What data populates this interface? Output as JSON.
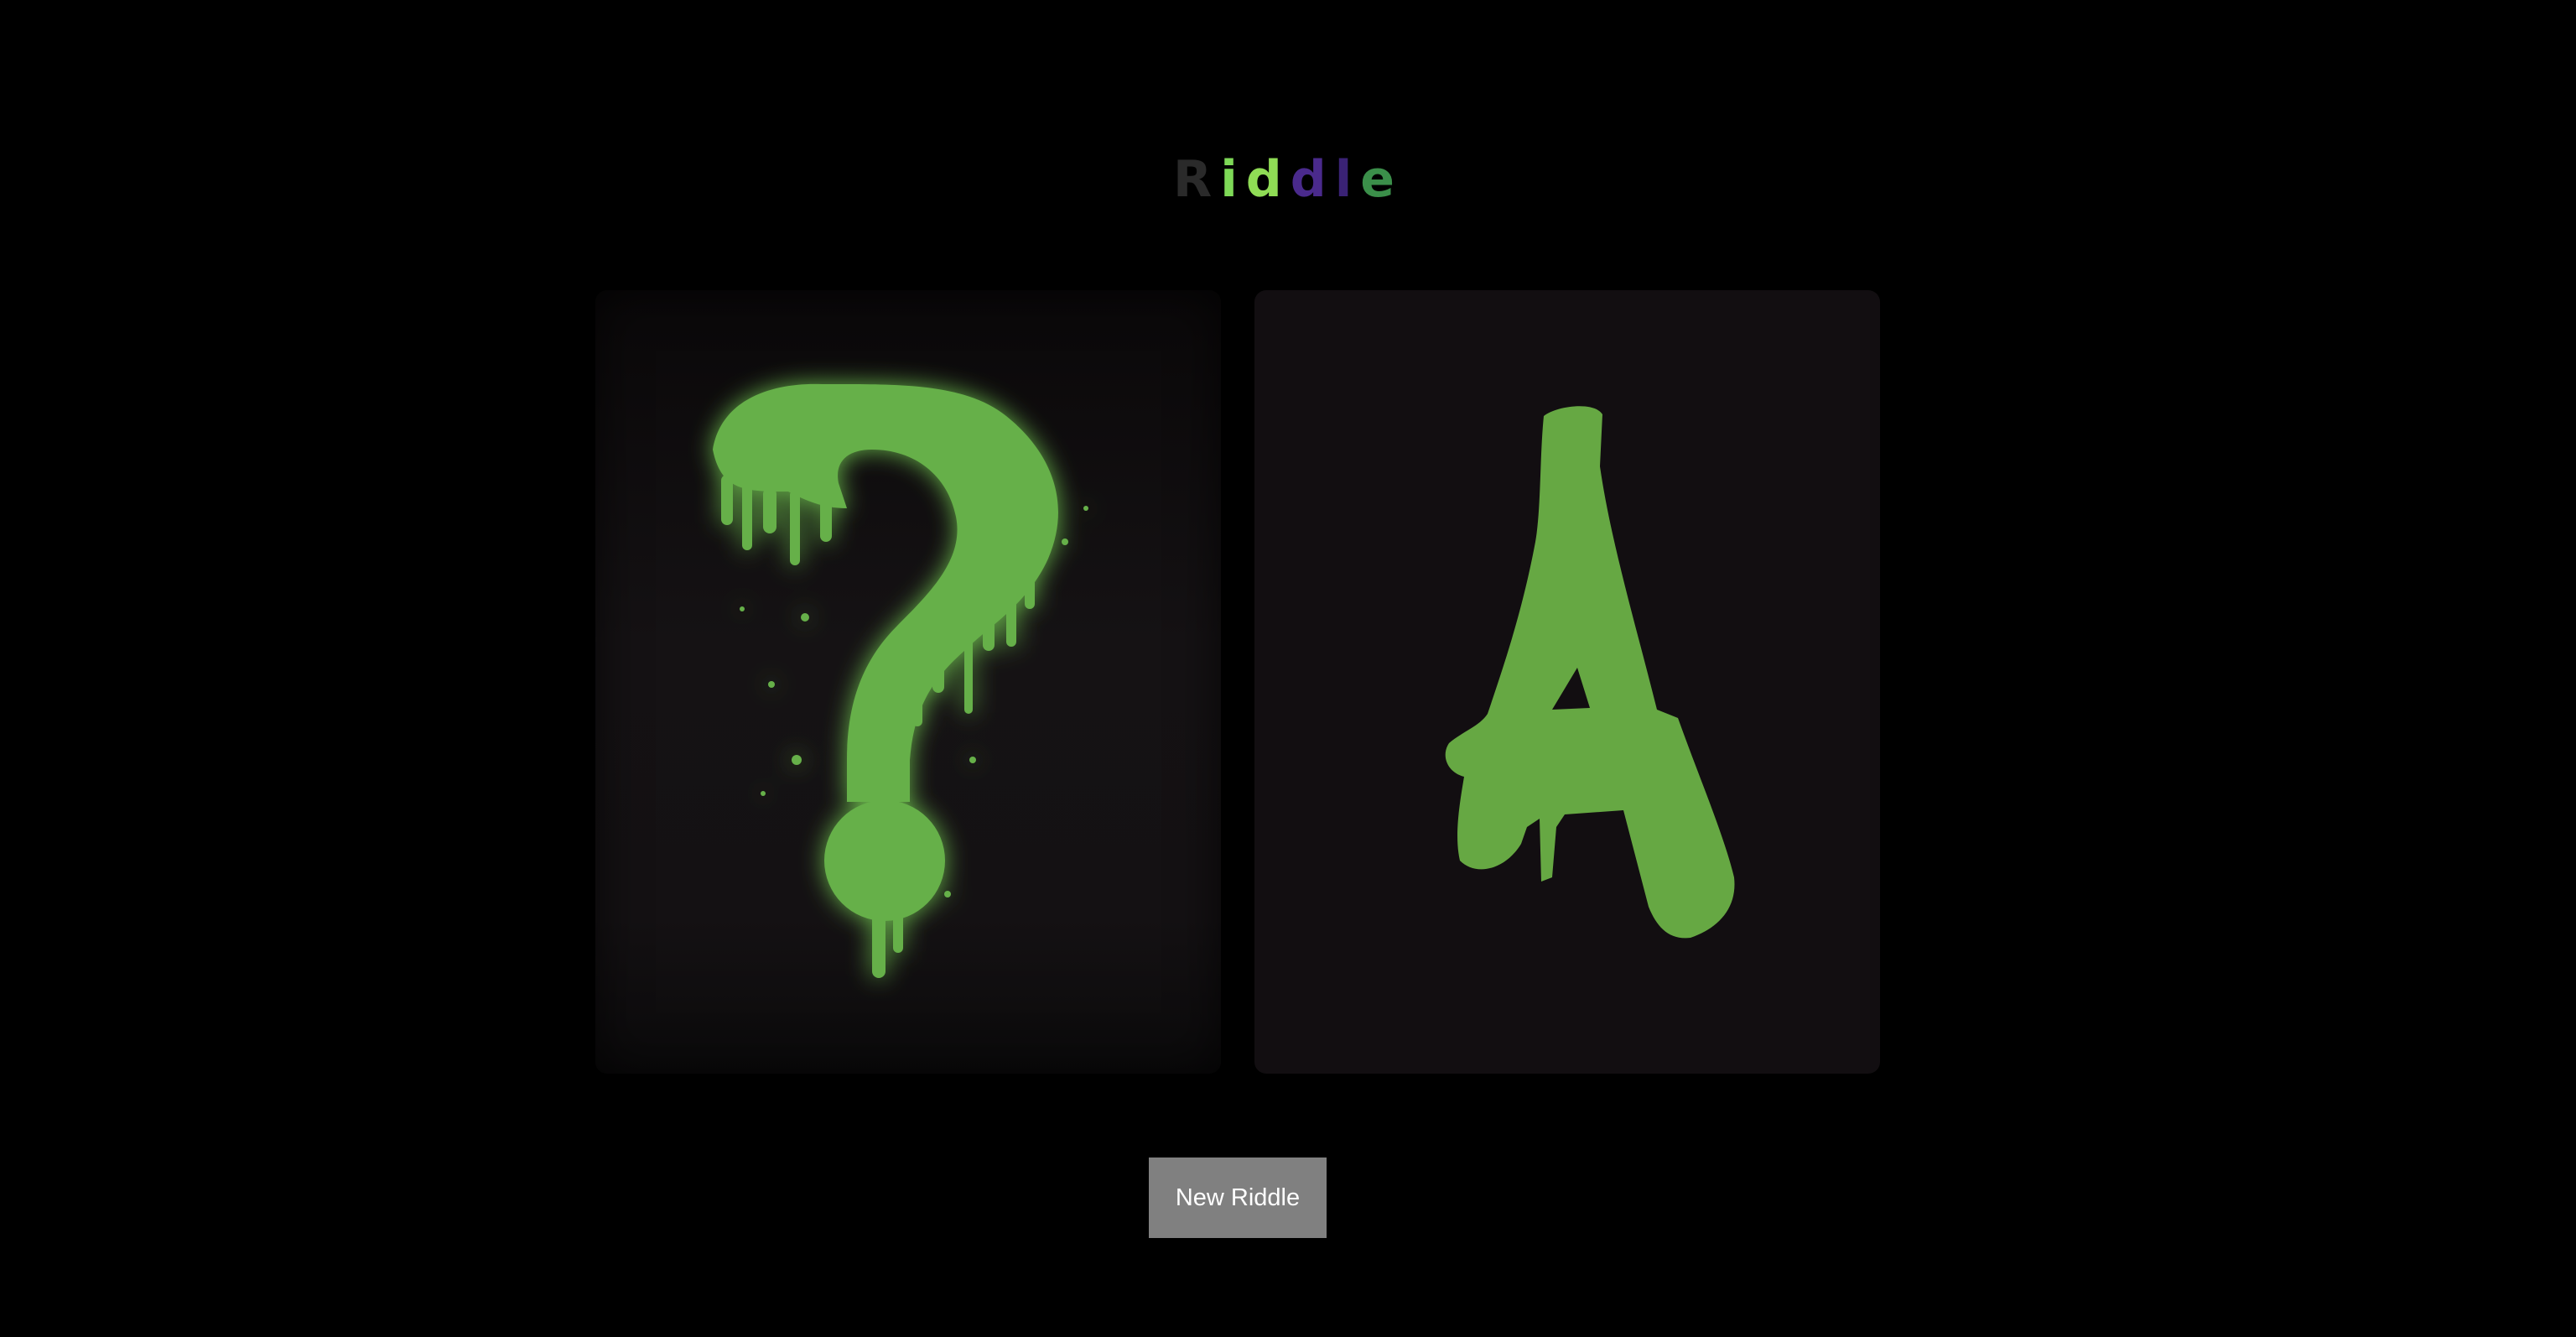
{
  "header": {
    "title_letters": [
      {
        "char": "R",
        "color": "#2a2a2a"
      },
      {
        "char": "i",
        "color": "#7ed957"
      },
      {
        "char": "d",
        "color": "#8fdc55"
      },
      {
        "char": "d",
        "color": "#4a2a8c"
      },
      {
        "char": "l",
        "color": "#3a2275"
      },
      {
        "char": "e",
        "color": "#3b8f4a"
      }
    ]
  },
  "cards": {
    "left": {
      "icon": "dripping-question-mark-icon",
      "color": "#66b04a"
    },
    "right": {
      "icon": "graffiti-letter-a-icon",
      "color": "#66a843"
    }
  },
  "actions": {
    "new_riddle_label": "New Riddle"
  }
}
